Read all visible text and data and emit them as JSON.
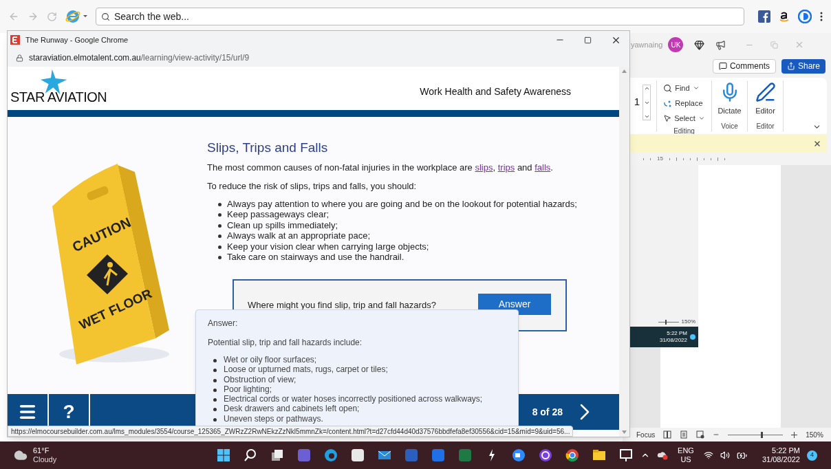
{
  "browser_toolbar": {
    "search": {
      "placeholder": "Search the web..."
    }
  },
  "word": {
    "user": "yawnaing",
    "avatar": "UK",
    "buttons": [
      {
        "label": "Comments",
        "kind": "outline"
      },
      {
        "label": "Share",
        "kind": "primary"
      }
    ],
    "ribbon": {
      "spin_value": "1",
      "groups": [
        {
          "label": "Editing",
          "items": [
            {
              "label": "Find",
              "kind": "find"
            },
            {
              "label": "Replace",
              "kind": "replace"
            },
            {
              "label": "Select",
              "kind": "select"
            }
          ]
        },
        {
          "label": "Voice",
          "items": [
            {
              "label": "Dictate",
              "kind": "mic"
            }
          ]
        },
        {
          "label": "Editor",
          "items": [
            {
              "label": "Editor",
              "kind": "pen"
            }
          ]
        }
      ]
    },
    "ruler_mark": "15",
    "embedded_image": {
      "zoom": "150%",
      "time": "5:22 PM",
      "date": "31/08/2022"
    },
    "status_bar": {
      "focus": "Focus",
      "zoom": "150%",
      "zoom_slider": {
        "level": 0.6
      }
    }
  },
  "chrome": {
    "title": "The Runway - Google Chrome",
    "url": {
      "domain": "staraviation.elmotalent.com.au",
      "path": "/learning/view-activity/15/url/9"
    },
    "status_url": "https://elmocoursebuilder.com.au/lms_modules/3554/course_125365_ZWRzZ2RwNEkzZzNkl5mmnZk=/content.html?t=d27cfd44d40d37576bbdfefa8ef30556&cid=15&mid=9&uid=56..."
  },
  "course": {
    "logo": {
      "left": "STAR",
      "right": "AVIATION"
    },
    "title": "Work Health and Safety Awareness",
    "sign": {
      "top": "CAUTION",
      "bottom": "WET FLOOR"
    },
    "heading": "Slips, Trips and Falls",
    "intro": [
      {
        "kind": "text",
        "text": "The most common causes of non-fatal injuries in the workplace are "
      },
      {
        "kind": "link",
        "text": "slips"
      },
      {
        "kind": "text",
        "text": ", "
      },
      {
        "kind": "link",
        "text": "trips"
      },
      {
        "kind": "text",
        "text": " and "
      },
      {
        "kind": "link",
        "text": "falls"
      },
      {
        "kind": "text",
        "text": "."
      }
    ],
    "lead": "To reduce the risk of slips, trips and falls, you should:",
    "tips": [
      "Always pay attention to where you are going and be on the lookout for potential hazards;",
      "Keep passageways clear;",
      "Clean up spills immediately;",
      "Always walk at an appropriate pace;",
      "Keep your vision clear when carrying large objects;",
      "Take care on stairways and use the handrail."
    ],
    "question": {
      "text": "Where might you find slip, trip and fall hazards?",
      "button": "Answer"
    },
    "answer": {
      "title": "Answer:",
      "lead": "Potential slip, trip and fall hazards include:",
      "items": [
        "Wet or oily floor surfaces;",
        "Loose or upturned mats, rugs, carpet or tiles;",
        "Obstruction of view;",
        "Poor lighting;",
        "Electrical cords or water hoses incorrectly positioned across walkways;",
        "Desk drawers and cabinets left open;",
        "Uneven steps or pathways."
      ]
    },
    "nav": {
      "help": "?",
      "page": "8 of 28"
    }
  },
  "taskbar": {
    "weather": {
      "temp": "61°F",
      "desc": "Cloudy"
    },
    "language": {
      "lang": "ENG",
      "region": "US"
    },
    "time": "5:22 PM",
    "date": "31/08/2022",
    "notifications": "4"
  }
}
